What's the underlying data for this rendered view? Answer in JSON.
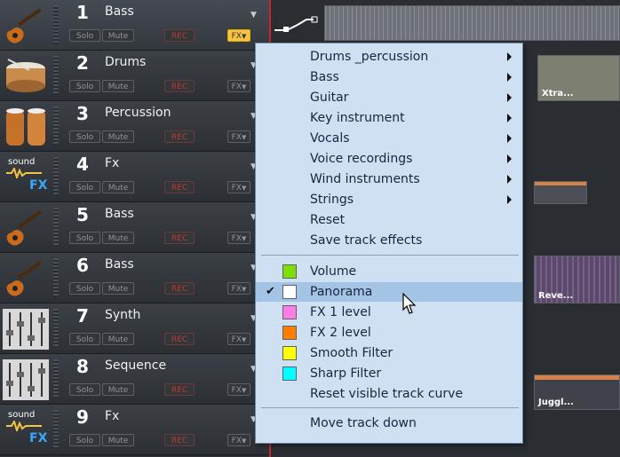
{
  "tracks": [
    {
      "num": "1",
      "name": "Bass",
      "icon": "bass-guitar-icon",
      "fx_active": true
    },
    {
      "num": "2",
      "name": "Drums",
      "icon": "drum-icon",
      "fx_active": false
    },
    {
      "num": "3",
      "name": "Percussion",
      "icon": "conga-drums-icon",
      "fx_active": false
    },
    {
      "num": "4",
      "name": "Fx",
      "icon": "sound-fx-icon",
      "fx_active": false
    },
    {
      "num": "5",
      "name": "Bass",
      "icon": "bass-guitar-icon",
      "fx_active": false
    },
    {
      "num": "6",
      "name": "Bass",
      "icon": "bass-guitar-icon",
      "fx_active": false
    },
    {
      "num": "7",
      "name": "Synth",
      "icon": "mixer-faders-icon",
      "fx_active": false
    },
    {
      "num": "8",
      "name": "Sequence",
      "icon": "mixer-faders-icon",
      "fx_active": false
    },
    {
      "num": "9",
      "name": "Fx",
      "icon": "sound-fx-icon",
      "fx_active": false
    }
  ],
  "buttons": {
    "solo": "Solo",
    "mute": "Mute",
    "rec": "REC",
    "fx": "FX"
  },
  "sound_fx_icon": {
    "line1": "sound",
    "line2": "FX"
  },
  "clips": {
    "xtra": "Xtra...",
    "reve": "Reve...",
    "juggl": "Juggl..."
  },
  "menu": {
    "group1": [
      {
        "label": "Drums _percussion",
        "submenu": true
      },
      {
        "label": "Bass",
        "submenu": true
      },
      {
        "label": "Guitar",
        "submenu": true
      },
      {
        "label": "Key instrument",
        "submenu": true
      },
      {
        "label": "Vocals",
        "submenu": true
      },
      {
        "label": "Voice recordings",
        "submenu": true
      },
      {
        "label": "Wind instruments",
        "submenu": true
      },
      {
        "label": "Strings",
        "submenu": true
      },
      {
        "label": "Reset",
        "submenu": false
      },
      {
        "label": "Save track effects",
        "submenu": false
      }
    ],
    "group2": [
      {
        "label": "Volume",
        "color": "#7ee000",
        "checked": false,
        "highlighted": false
      },
      {
        "label": "Panorama",
        "color": "#ffffff",
        "checked": true,
        "highlighted": true
      },
      {
        "label": "FX 1 level",
        "color": "#ff7be6",
        "checked": false,
        "highlighted": false
      },
      {
        "label": "FX 2 level",
        "color": "#ff7d00",
        "checked": false,
        "highlighted": false
      },
      {
        "label": "Smooth Filter",
        "color": "#ffff00",
        "checked": false,
        "highlighted": false
      },
      {
        "label": "Sharp Filter",
        "color": "#00ffff",
        "checked": false,
        "highlighted": false
      },
      {
        "label": "Reset visible track curve",
        "color": null,
        "checked": false,
        "highlighted": false
      }
    ],
    "group3": [
      {
        "label": "Move track down"
      }
    ]
  },
  "colors": {
    "record_red": "#c8262b",
    "fx_active": "#f5c542",
    "menu_bg": "#cfe0f3",
    "menu_highlight": "#a4c4e6"
  }
}
